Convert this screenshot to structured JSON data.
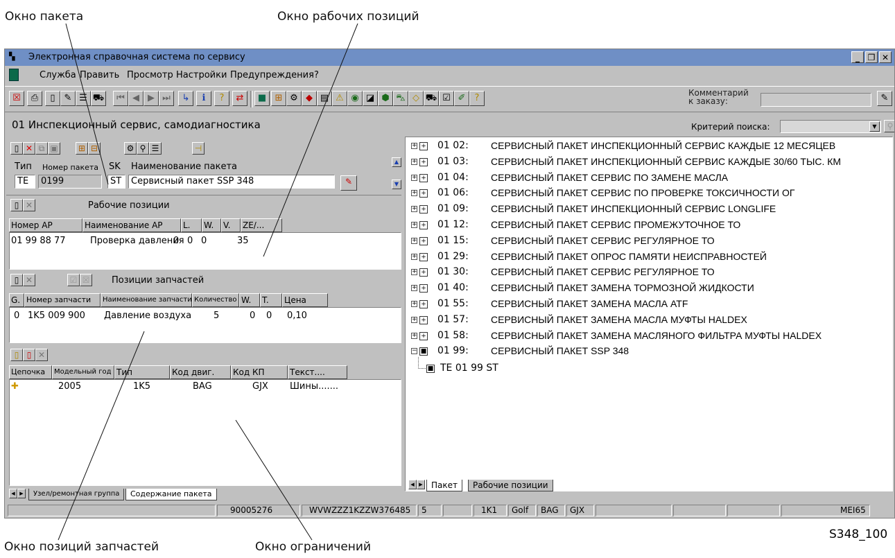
{
  "callouts": {
    "package_window": "Окно пакета",
    "work_positions_window": "Окно рабочих позиций",
    "parts_window": "Окно позиций запчастей",
    "restrictions_window": "Окно ограничений",
    "figure_code": "S348_100"
  },
  "window": {
    "title": "Электронная справочная система по сервису",
    "controls": [
      "_",
      "ä",
      "X"
    ]
  },
  "menu": {
    "items": [
      "Служба",
      "Править",
      "Просмотр",
      "Настройки",
      "Предупреждения",
      "?"
    ]
  },
  "toolbar": {
    "comment_label": "Комментарий\nк заказу:",
    "comment_value": ""
  },
  "header": {
    "page_title": "01 Инспекционный сервис, самодиагностика",
    "search_label": "Критерий поиска:",
    "search_value": ""
  },
  "package_form": {
    "labels": {
      "type": "Тип",
      "number": "Номер пакета",
      "sk": "SK",
      "name": "Наименование пакета"
    },
    "values": {
      "type": "TE",
      "number": "0199",
      "sk": "ST",
      "name": "Сервисный пакет SSP 348"
    }
  },
  "work_positions": {
    "title": "Рабочие позиции",
    "columns": [
      "Номер АР",
      "Наименование АР",
      "L.",
      "W.",
      "V.",
      "ZE/..."
    ],
    "rows": [
      [
        "01 99 88 77",
        "Проверка давления",
        "0",
        "0",
        "0",
        "35"
      ]
    ]
  },
  "parts": {
    "title": "Позиции запчастей",
    "columns": [
      "G.",
      "Номер запчасти",
      "Наименование запчасти",
      "Количество",
      "W.",
      "T.",
      "Цена"
    ],
    "rows": [
      [
        "0",
        "1K5 009 900",
        "Давление воздуха",
        "5",
        "0",
        "0",
        "0,10"
      ]
    ]
  },
  "restrictions": {
    "columns": [
      "Цепочка",
      "Модельный год",
      "Тип",
      "Код двиг.",
      "Код КП",
      "Текст...."
    ],
    "rows": [
      [
        "2005",
        "1K5",
        "BAG",
        "GJX",
        "Шины......."
      ]
    ]
  },
  "left_tabs": [
    "Узел/ремонтная группа",
    "Содержание пакета"
  ],
  "tree": {
    "items": [
      {
        "code": "01 02:",
        "name": "СЕРВИСНЫЙ ПАКЕТ ИНСПЕКЦИОННЫЙ СЕРВИС КАЖДЫЕ 12 МЕСЯЦЕВ"
      },
      {
        "code": "01 03:",
        "name": "СЕРВИСНЫЙ ПАКЕТ ИНСПЕКЦИОННЫЙ СЕРВИС КАЖДЫЕ 30/60 ТЫС. КМ"
      },
      {
        "code": "01 04:",
        "name": "СЕРВИСНЫЙ ПАКЕТ СЕРВИС ПО ЗАМЕНЕ МАСЛА"
      },
      {
        "code": "01 06:",
        "name": "СЕРВИСНЫЙ ПАКЕТ СЕРВИС ПО ПРОВЕРКЕ ТОКСИЧНОСТИ ОГ"
      },
      {
        "code": "01 09:",
        "name": "СЕРВИСНЫЙ ПАКЕТ ИНСПЕКЦИОННЫЙ СЕРВИС LONGLIFE"
      },
      {
        "code": "01 12:",
        "name": "СЕРВИСНЫЙ ПАКЕТ СЕРВИС ПРОМЕЖУТОЧНОЕ ТО"
      },
      {
        "code": "01 15:",
        "name": "СЕРВИСНЫЙ ПАКЕТ СЕРВИС РЕГУЛЯРНОЕ ТО"
      },
      {
        "code": "01 29:",
        "name": "СЕРВИСНЫЙ ПАКЕТ ОПРОС ПАМЯТИ НЕИСПРАВНОСТЕЙ"
      },
      {
        "code": "01 30:",
        "name": "СЕРВИСНЫЙ ПАКЕТ СЕРВИС РЕГУЛЯРНОЕ ТО"
      },
      {
        "code": "01 40:",
        "name": "СЕРВИСНЫЙ ПАКЕТ ЗАМЕНА ТОРМОЗНОЙ ЖИДКОСТИ"
      },
      {
        "code": "01 55:",
        "name": "СЕРВИСНЫЙ ПАКЕТ ЗАМЕНА МАСЛА ATF"
      },
      {
        "code": "01 57:",
        "name": "СЕРВИСНЫЙ ПАКЕТ ЗАМЕНА МАСЛА МУФТЫ HALDEX"
      },
      {
        "code": "01 58:",
        "name": "СЕРВИСНЫЙ ПАКЕТ ЗАМЕНА МАСЛЯНОГО ФИЛЬТРА МУФТЫ HALDEX"
      },
      {
        "code": "01 99:",
        "name": "СЕРВИСНЫЙ ПАКЕТ SSP 348"
      }
    ],
    "child": "TE 01 99 ST"
  },
  "right_tabs": [
    "Пакет",
    "Рабочие позиции"
  ],
  "status": {
    "order": "90005276",
    "vin": "WVWZZZ1KZZW376485",
    "num": "5",
    "model_code": "1K1",
    "model": "Golf",
    "engine": "BAG",
    "gearbox": "GJX",
    "user": "MEI65"
  }
}
